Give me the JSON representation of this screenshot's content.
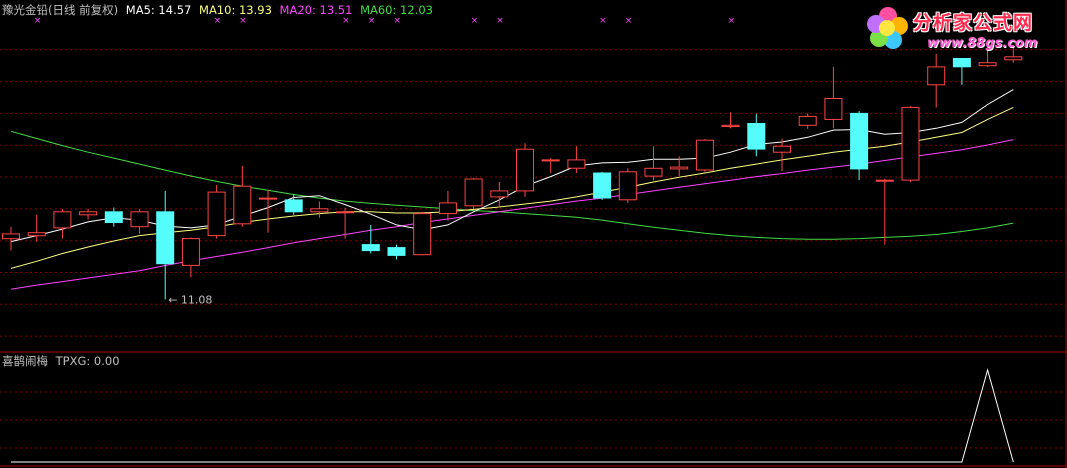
{
  "header": {
    "title": "豫光金铅(日线 前复权)",
    "ma5": "MA5: 14.57",
    "ma10": "MA10: 13.93",
    "ma20": "MA20: 13.51",
    "ma60": "MA60: 12.03"
  },
  "indicator": {
    "name": "喜鹊闹梅",
    "value": "TPXG: 0.00"
  },
  "logo": {
    "text": "分析家公式网",
    "url": "www.88gs.com"
  },
  "annotation": {
    "low_label": "← 11.08"
  },
  "colors": {
    "up": "#ff4444",
    "down": "#54fcfc",
    "ma5": "#ffffff",
    "ma10": "#ffff80",
    "ma20": "#ff44ff",
    "ma60": "#44dd44",
    "grid": "#8b0000",
    "marker": "#ff44ff",
    "header_title": "#c0c0c0"
  },
  "chart_data": {
    "type": "candlestick",
    "price_range": [
      10.4,
      15.8
    ],
    "candles": [
      {
        "o": 12.1,
        "c": 12.18,
        "h": 12.3,
        "l": 11.9
      },
      {
        "o": 12.15,
        "c": 12.2,
        "h": 12.5,
        "l": 12.05
      },
      {
        "o": 12.28,
        "c": 12.55,
        "h": 12.6,
        "l": 12.1
      },
      {
        "o": 12.5,
        "c": 12.55,
        "h": 12.6,
        "l": 12.42
      },
      {
        "o": 12.55,
        "c": 12.37,
        "h": 12.62,
        "l": 12.3
      },
      {
        "o": 12.3,
        "c": 12.55,
        "h": 12.6,
        "l": 12.18
      },
      {
        "o": 12.55,
        "c": 11.68,
        "h": 12.9,
        "l": 11.08
      },
      {
        "o": 11.65,
        "c": 12.1,
        "h": 12.12,
        "l": 11.45
      },
      {
        "o": 12.15,
        "c": 12.88,
        "h": 13.0,
        "l": 12.1
      },
      {
        "o": 12.35,
        "c": 12.98,
        "h": 13.32,
        "l": 12.3
      },
      {
        "o": 12.78,
        "c": 12.78,
        "h": 12.92,
        "l": 12.2
      },
      {
        "o": 12.75,
        "c": 12.55,
        "h": 12.85,
        "l": 12.5
      },
      {
        "o": 12.55,
        "c": 12.6,
        "h": 12.72,
        "l": 12.45
      },
      {
        "o": 12.55,
        "c": 12.55,
        "h": 12.62,
        "l": 12.1
      },
      {
        "o": 12.0,
        "c": 11.9,
        "h": 12.33,
        "l": 11.85
      },
      {
        "o": 11.95,
        "c": 11.82,
        "h": 12.0,
        "l": 11.75
      },
      {
        "o": 11.83,
        "c": 12.52,
        "h": 12.55,
        "l": 11.82
      },
      {
        "o": 12.52,
        "c": 12.7,
        "h": 12.9,
        "l": 12.4
      },
      {
        "o": 12.65,
        "c": 13.1,
        "h": 13.12,
        "l": 12.6
      },
      {
        "o": 12.8,
        "c": 12.9,
        "h": 13.05,
        "l": 12.62
      },
      {
        "o": 12.9,
        "c": 13.6,
        "h": 13.7,
        "l": 12.8
      },
      {
        "o": 13.42,
        "c": 13.42,
        "h": 13.45,
        "l": 13.2
      },
      {
        "o": 13.28,
        "c": 13.42,
        "h": 13.65,
        "l": 13.2
      },
      {
        "o": 13.2,
        "c": 12.78,
        "h": 13.22,
        "l": 12.75
      },
      {
        "o": 12.75,
        "c": 13.22,
        "h": 13.28,
        "l": 12.7
      },
      {
        "o": 13.15,
        "c": 13.28,
        "h": 13.65,
        "l": 13.08
      },
      {
        "o": 13.27,
        "c": 13.3,
        "h": 13.48,
        "l": 13.15
      },
      {
        "o": 13.25,
        "c": 13.75,
        "h": 13.77,
        "l": 13.22
      },
      {
        "o": 13.98,
        "c": 14.0,
        "h": 14.22,
        "l": 13.95
      },
      {
        "o": 14.03,
        "c": 13.6,
        "h": 14.19,
        "l": 13.48
      },
      {
        "o": 13.55,
        "c": 13.65,
        "h": 13.78,
        "l": 13.23
      },
      {
        "o": 14.0,
        "c": 14.15,
        "h": 14.2,
        "l": 13.94
      },
      {
        "o": 14.1,
        "c": 14.45,
        "h": 14.98,
        "l": 13.95
      },
      {
        "o": 14.2,
        "c": 13.27,
        "h": 14.24,
        "l": 13.08
      },
      {
        "o": 13.08,
        "c": 13.08,
        "h": 13.1,
        "l": 12.0
      },
      {
        "o": 13.08,
        "c": 14.3,
        "h": 14.32,
        "l": 13.05
      },
      {
        "o": 14.68,
        "c": 14.98,
        "h": 15.2,
        "l": 14.3
      },
      {
        "o": 15.12,
        "c": 14.98,
        "h": 15.12,
        "l": 14.68
      },
      {
        "o": 15.0,
        "c": 15.05,
        "h": 15.42,
        "l": 14.98
      },
      {
        "o": 15.1,
        "c": 15.15,
        "h": 15.35,
        "l": 15.05
      }
    ],
    "ma5": [
      12.05,
      12.15,
      12.26,
      12.38,
      12.45,
      12.41,
      12.31,
      12.28,
      12.33,
      12.48,
      12.62,
      12.79,
      12.82,
      12.67,
      12.51,
      12.33,
      12.25,
      12.33,
      12.55,
      12.75,
      12.98,
      13.14,
      13.32,
      13.37,
      13.38,
      13.43,
      13.43,
      13.45,
      13.55,
      13.68,
      13.72,
      13.8,
      13.92,
      13.93,
      13.85,
      13.88,
      13.95,
      14.05,
      14.35,
      14.6
    ],
    "ma10": [
      11.6,
      11.72,
      11.85,
      11.96,
      12.06,
      12.15,
      12.2,
      12.24,
      12.3,
      12.37,
      12.43,
      12.48,
      12.52,
      12.55,
      12.55,
      12.53,
      12.53,
      12.55,
      12.59,
      12.63,
      12.68,
      12.73,
      12.8,
      12.88,
      12.96,
      13.05,
      13.13,
      13.2,
      13.28,
      13.35,
      13.42,
      13.48,
      13.55,
      13.6,
      13.65,
      13.72,
      13.8,
      13.88,
      14.1,
      14.3
    ],
    "ma20": [
      11.25,
      11.32,
      11.38,
      11.44,
      11.5,
      11.56,
      11.65,
      11.73,
      11.8,
      11.87,
      11.95,
      12.03,
      12.1,
      12.17,
      12.24,
      12.3,
      12.37,
      12.43,
      12.49,
      12.55,
      12.61,
      12.67,
      12.73,
      12.78,
      12.84,
      12.9,
      12.96,
      13.02,
      13.08,
      13.14,
      13.19,
      13.25,
      13.3,
      13.35,
      13.41,
      13.47,
      13.53,
      13.59,
      13.67,
      13.76
    ],
    "ma60": [
      13.9,
      13.78,
      13.66,
      13.55,
      13.45,
      13.35,
      13.25,
      13.15,
      13.06,
      12.98,
      12.91,
      12.84,
      12.78,
      12.73,
      12.69,
      12.66,
      12.63,
      12.6,
      12.57,
      12.55,
      12.52,
      12.49,
      12.46,
      12.41,
      12.35,
      12.29,
      12.24,
      12.19,
      12.15,
      12.12,
      12.1,
      12.09,
      12.09,
      12.1,
      12.12,
      12.14,
      12.17,
      12.22,
      12.28,
      12.36
    ],
    "signal_markers": [
      1,
      8,
      9,
      13,
      14,
      15,
      18,
      19,
      23,
      24,
      28
    ],
    "tpxg": [
      0,
      0,
      0,
      0,
      0,
      0,
      0,
      0,
      0,
      0,
      0,
      0,
      0,
      0,
      0,
      0,
      0,
      0,
      0,
      0,
      0,
      0,
      0,
      0,
      0,
      0,
      0,
      0,
      0,
      0,
      0,
      0,
      0,
      0,
      0,
      0,
      0,
      0,
      1,
      0
    ]
  }
}
